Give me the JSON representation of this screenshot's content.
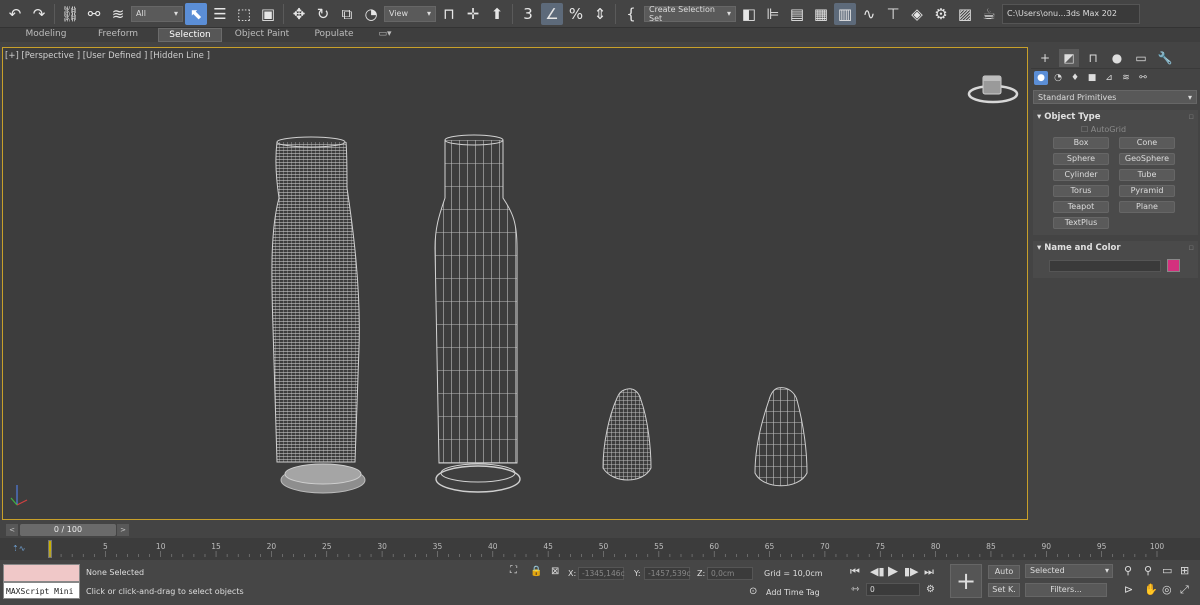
{
  "toolbar": {
    "filter_select": "All",
    "ref_coord_select": "View",
    "selection_set_select": "Create Selection Set",
    "project_path": "C:\\Users\\onu...3ds Max 202"
  },
  "ribbon": {
    "tabs": [
      "Modeling",
      "Freeform",
      "Selection",
      "Object Paint",
      "Populate"
    ],
    "active_tab": "Selection"
  },
  "viewport": {
    "label": "[+] [Perspective ] [User Defined ] [Hidden Line ]"
  },
  "command_panel": {
    "category_select": "Standard Primitives",
    "object_type": {
      "title": "Object Type",
      "autogrid": "AutoGrid",
      "buttons": [
        "Box",
        "Cone",
        "Sphere",
        "GeoSphere",
        "Cylinder",
        "Tube",
        "Torus",
        "Pyramid",
        "Teapot",
        "Plane",
        "TextPlus"
      ]
    },
    "name_and_color": {
      "title": "Name and Color",
      "color": "#d4307e"
    }
  },
  "time_slider": {
    "value": "0 / 100",
    "ticks": [
      "5",
      "10",
      "15",
      "20",
      "25",
      "30",
      "35",
      "40",
      "45",
      "50",
      "55",
      "60",
      "65",
      "70",
      "75",
      "80",
      "85",
      "90",
      "95",
      "100"
    ]
  },
  "status": {
    "maxscript_label": "MAXScript Mini",
    "selection_status": "None Selected",
    "prompt": "Click or click-and-drag to select objects",
    "x_label": "X:",
    "x_value": "-1345,146c",
    "y_label": "Y:",
    "y_value": "-1457,539c",
    "z_label": "Z:",
    "z_value": "0,0cm",
    "grid": "Grid = 10,0cm",
    "add_time_tag": "Add Time Tag",
    "frame_value": "0",
    "auto_key": "Auto",
    "set_key": "Set K.",
    "key_filter_select": "Selected",
    "filters_button": "Filters..."
  }
}
